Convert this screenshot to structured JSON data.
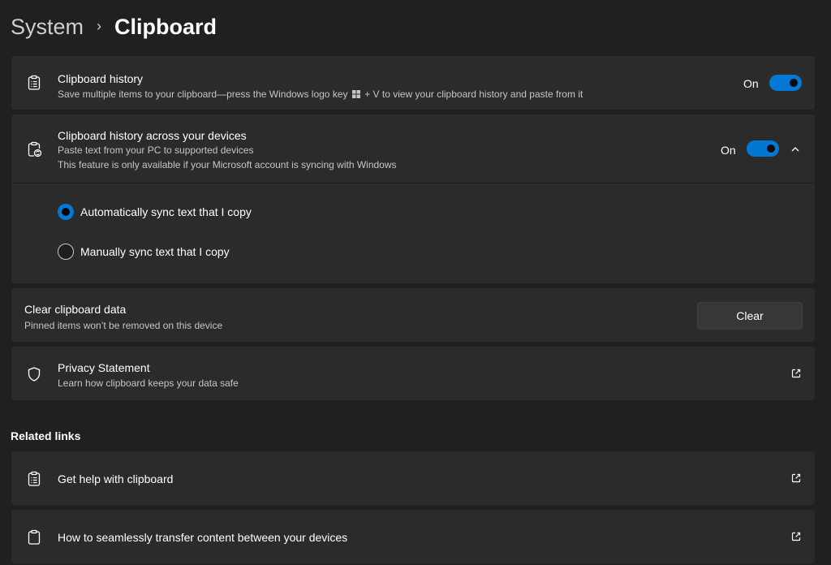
{
  "breadcrumb": {
    "parent": "System",
    "separator": "›",
    "current": "Clipboard"
  },
  "clipboard_history": {
    "title": "Clipboard history",
    "desc_before_key": "Save multiple items to your clipboard—press the Windows logo key",
    "desc_after_key": "+ V to view your clipboard history and paste from it",
    "toggle_label": "On",
    "toggle_on": true
  },
  "cross_device": {
    "title": "Clipboard history across your devices",
    "desc1": "Paste text from your PC to supported devices",
    "desc2": "This feature is only available if your Microsoft account is syncing with Windows",
    "toggle_label": "On",
    "toggle_on": true,
    "expanded": true,
    "options": [
      {
        "label": "Automatically sync text that I copy",
        "selected": true
      },
      {
        "label": "Manually sync text that I copy",
        "selected": false
      }
    ]
  },
  "clear_data": {
    "title": "Clear clipboard data",
    "desc": "Pinned items won’t be removed on this device",
    "button_label": "Clear"
  },
  "privacy": {
    "title": "Privacy Statement",
    "desc": "Learn how clipboard keeps your data safe"
  },
  "related": {
    "heading": "Related links",
    "links": [
      {
        "label": "Get help with clipboard",
        "icon": "clipboard-list-icon"
      },
      {
        "label": "How to seamlessly transfer content between your devices",
        "icon": "clipboard-icon"
      }
    ]
  },
  "colors": {
    "accent": "#0078d4",
    "background": "#202020",
    "card": "#2b2b2b"
  }
}
